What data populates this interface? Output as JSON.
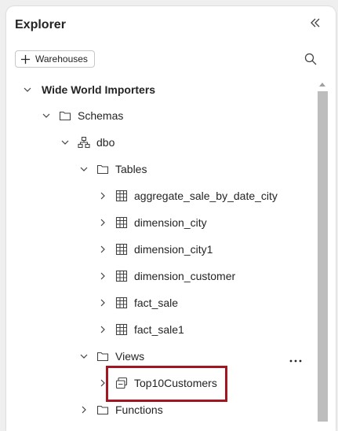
{
  "explorer": {
    "title": "Explorer",
    "warehouses_button": "Warehouses"
  },
  "tree": {
    "root": "Wide World Importers",
    "schemas": "Schemas",
    "dbo": "dbo",
    "tables": "Tables",
    "table_items": [
      "aggregate_sale_by_date_city",
      "dimension_city",
      "dimension_city1",
      "dimension_customer",
      "fact_sale",
      "fact_sale1"
    ],
    "views": "Views",
    "view_items": [
      "Top10Customers"
    ],
    "functions": "Functions"
  },
  "colors": {
    "highlight_border": "#a21621",
    "scroll_thumb": "#bdbdbd"
  }
}
